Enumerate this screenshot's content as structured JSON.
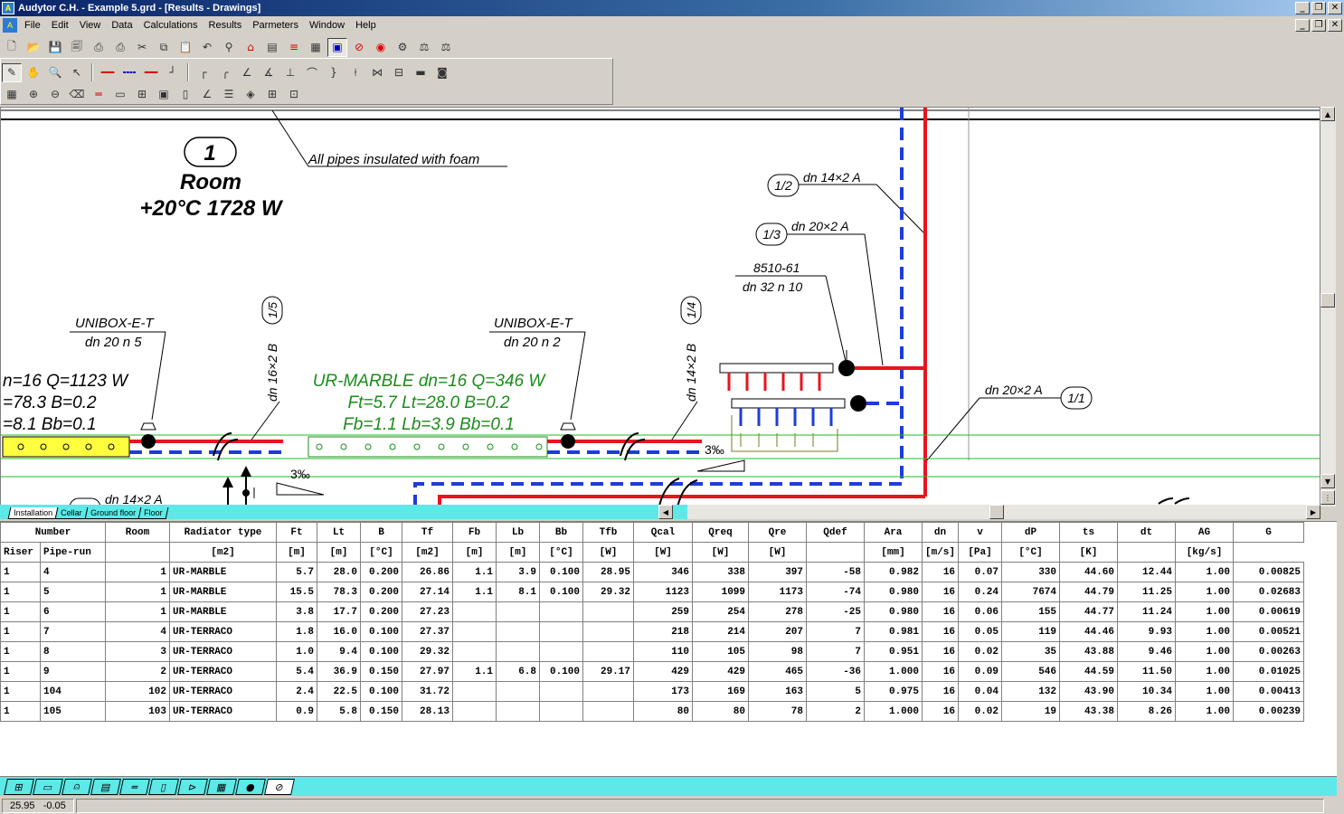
{
  "window": {
    "title": "Audytor C.H.  - Example 5.grd - [Results -  Drawings]",
    "minimize": "_",
    "restore": "❐",
    "close": "✕"
  },
  "menu": [
    "File",
    "Edit",
    "View",
    "Data",
    "Calculations",
    "Results",
    "Parmeters",
    "Window",
    "Help"
  ],
  "sheet_tabs": [
    "Installation",
    "Cellar",
    "Ground floor",
    "Floor"
  ],
  "drawing": {
    "annotation_insulation": "All pipes insulated with foam",
    "room_number": "1",
    "room_title": "Room",
    "room_info": "+20°C 1728 W",
    "pipe_1_2": "dn 14×2 A",
    "pipe_1_2_tag": "1/2",
    "pipe_1_3": "dn 20×2 A",
    "pipe_1_3_tag": "1/3",
    "manifold_type": "8510-61",
    "manifold_size": "dn 32  n 10",
    "unibox_1": "UNIBOX-E-T",
    "unibox_1_size": "dn 20  n 5",
    "unibox_2": "UNIBOX-E-T",
    "unibox_2_size": "dn 20  n 2",
    "pipe_1_5": "dn 16×2 B",
    "pipe_1_5_tag": "1/5",
    "pipe_1_4": "dn 14×2 B",
    "pipe_1_4_tag": "1/4",
    "pipe_1_1": "dn 20×2 A",
    "pipe_1_1_tag": "1/1",
    "left_rad_line1": "n=16 Q=1123 W",
    "left_rad_line2": "=78.3 B=0.2",
    "left_rad_line3": "=8.1 Bb=0.1",
    "marble_line1": "UR-MARBLE dn=16 Q=346 W",
    "marble_line2": "Ft=5.7 Lt=28.0 B=0.2",
    "marble_line3": "Fb=1.1 Lb=3.9 Bb=0.1",
    "slope_1": "3‰",
    "slope_2": "3‰",
    "bottom_pipe": "dn 14×2 A",
    "colors": {
      "supply": "#e8141e",
      "return": "#1e3cdc",
      "annotation_green": "#1a8c1a",
      "radiator_yellow": "#ffff40"
    }
  },
  "table": {
    "headers": [
      "Number",
      "Room",
      "Radiator type",
      "Ft",
      "Lt",
      "B",
      "Tf",
      "Fb",
      "Lb",
      "Bb",
      "Tfb",
      "Qcal",
      "Qreq",
      "Qre",
      "Qdef",
      "Ara",
      "dn",
      "v",
      "dP",
      "ts",
      "dt",
      "AG",
      "G"
    ],
    "subheaders": [
      "Riser",
      "Pipe-run",
      "",
      "",
      "[m2]",
      "[m]",
      "[m]",
      "[°C]",
      "[m2]",
      "[m]",
      "[m]",
      "[°C]",
      "[W]",
      "[W]",
      "[W]",
      "[W]",
      "",
      "[mm]",
      "[m/s]",
      "[Pa]",
      "[°C]",
      "[K]",
      "",
      "[kg/s]"
    ],
    "rows": [
      [
        "1",
        "4",
        "1",
        "UR-MARBLE",
        "5.7",
        "28.0",
        "0.200",
        "26.86",
        "1.1",
        "3.9",
        "0.100",
        "28.95",
        "346",
        "338",
        "397",
        "-58",
        "0.982",
        "16",
        "0.07",
        "330",
        "44.60",
        "12.44",
        "1.00",
        "0.00825"
      ],
      [
        "1",
        "5",
        "1",
        "UR-MARBLE",
        "15.5",
        "78.3",
        "0.200",
        "27.14",
        "1.1",
        "8.1",
        "0.100",
        "29.32",
        "1123",
        "1099",
        "1173",
        "-74",
        "0.980",
        "16",
        "0.24",
        "7674",
        "44.79",
        "11.25",
        "1.00",
        "0.02683"
      ],
      [
        "1",
        "6",
        "1",
        "UR-MARBLE",
        "3.8",
        "17.7",
        "0.200",
        "27.23",
        "",
        "",
        "",
        "",
        "259",
        "254",
        "278",
        "-25",
        "0.980",
        "16",
        "0.06",
        "155",
        "44.77",
        "11.24",
        "1.00",
        "0.00619"
      ],
      [
        "1",
        "7",
        "4",
        "UR-TERRACO",
        "1.8",
        "16.0",
        "0.100",
        "27.37",
        "",
        "",
        "",
        "",
        "218",
        "214",
        "207",
        "7",
        "0.981",
        "16",
        "0.05",
        "119",
        "44.46",
        "9.93",
        "1.00",
        "0.00521"
      ],
      [
        "1",
        "8",
        "3",
        "UR-TERRACO",
        "1.0",
        "9.4",
        "0.100",
        "29.32",
        "",
        "",
        "",
        "",
        "110",
        "105",
        "98",
        "7",
        "0.951",
        "16",
        "0.02",
        "35",
        "43.88",
        "9.46",
        "1.00",
        "0.00263"
      ],
      [
        "1",
        "9",
        "2",
        "UR-TERRACO",
        "5.4",
        "36.9",
        "0.150",
        "27.97",
        "1.1",
        "6.8",
        "0.100",
        "29.17",
        "429",
        "429",
        "465",
        "-36",
        "1.000",
        "16",
        "0.09",
        "546",
        "44.59",
        "11.50",
        "1.00",
        "0.01025"
      ],
      [
        "1",
        "104",
        "102",
        "UR-TERRACO",
        "2.4",
        "22.5",
        "0.100",
        "31.72",
        "",
        "",
        "",
        "",
        "173",
        "169",
        "163",
        "5",
        "0.975",
        "16",
        "0.04",
        "132",
        "43.90",
        "10.34",
        "1.00",
        "0.00413"
      ],
      [
        "1",
        "105",
        "103",
        "UR-TERRACO",
        "0.9",
        "5.8",
        "0.150",
        "28.13",
        "",
        "",
        "",
        "",
        "80",
        "80",
        "78",
        "2",
        "1.000",
        "16",
        "0.02",
        "19",
        "43.38",
        "8.26",
        "1.00",
        "0.00239"
      ]
    ]
  },
  "status": {
    "x": "25.95",
    "y": "-0.05"
  }
}
